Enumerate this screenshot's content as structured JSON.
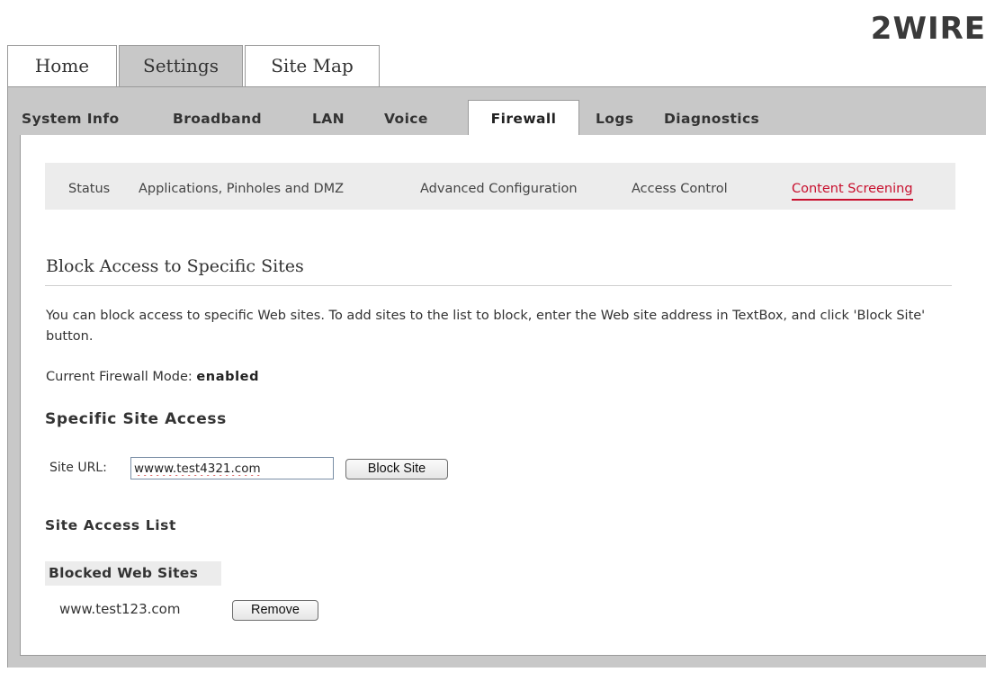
{
  "brand": {
    "logo_text": "2WIRE"
  },
  "main_tabs": [
    {
      "label": "Home",
      "active": false
    },
    {
      "label": "Settings",
      "active": true
    },
    {
      "label": "Site Map",
      "active": false
    }
  ],
  "sub_tabs": [
    {
      "label": "System Info",
      "active": false
    },
    {
      "label": "Broadband",
      "active": false
    },
    {
      "label": "LAN",
      "active": false
    },
    {
      "label": "Voice",
      "active": false
    },
    {
      "label": "Firewall",
      "active": true
    },
    {
      "label": "Logs",
      "active": false
    },
    {
      "label": "Diagnostics",
      "active": false
    }
  ],
  "firewall_nav": [
    {
      "label": "Status",
      "active": false
    },
    {
      "label": "Applications, Pinholes and DMZ",
      "active": false
    },
    {
      "label": "Advanced Configuration",
      "active": false
    },
    {
      "label": "Access Control",
      "active": false
    },
    {
      "label": "Content Screening",
      "active": true
    }
  ],
  "content": {
    "title": "Block Access to Specific Sites",
    "description": "You can block access to specific Web sites. To add sites to the list to block, enter the Web site address in TextBox, and click 'Block Site' button.",
    "mode_label": "Current Firewall Mode: ",
    "mode_value": "enabled",
    "specific_heading": "Specific Site Access",
    "site_url_label": "Site URL:",
    "site_url_value": "wwww.test4321.com",
    "block_button": "Block Site",
    "list_heading": "Site Access List",
    "blocked_header": "Blocked Web Sites",
    "blocked_sites": [
      {
        "url": "www.test123.com",
        "remove_label": "Remove"
      }
    ]
  },
  "colors": {
    "active_tab_bg": "#c8c8c8",
    "frame_bg": "#c8c8c8",
    "nav_bg": "#ececec",
    "active_link": "#c8102e"
  }
}
